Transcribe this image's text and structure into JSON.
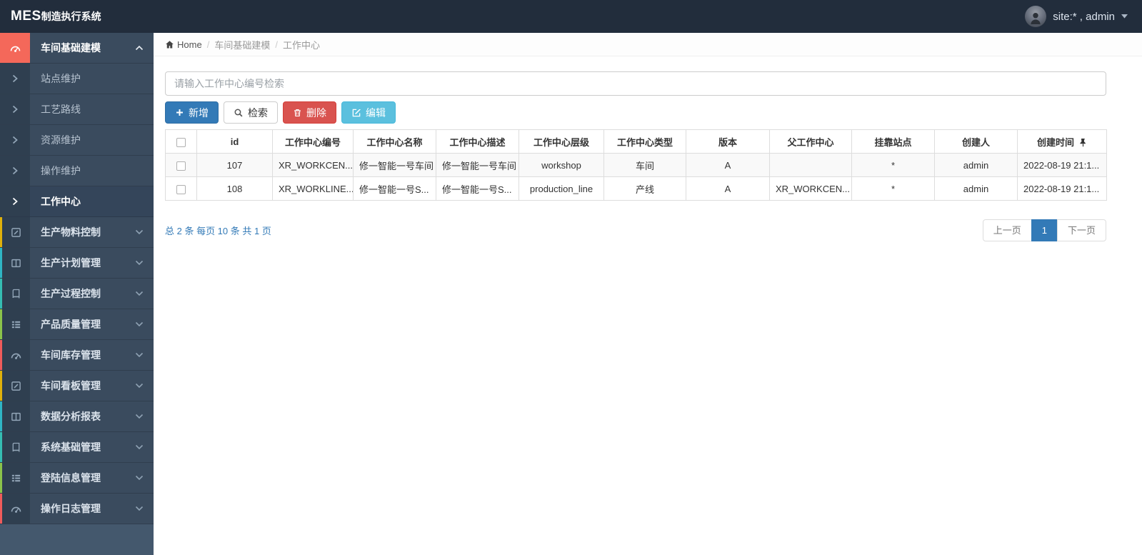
{
  "navbar": {
    "brand_bold": "MES",
    "brand_rest": "制造执行系统",
    "user_label": "site:* , admin"
  },
  "breadcrumb": {
    "items": [
      "Home",
      "车间基础建模",
      "工作中心"
    ]
  },
  "sidebar": {
    "active_group": {
      "label": "车间基础建模",
      "icon": "tachometer-icon"
    },
    "sub_items": [
      {
        "label": "站点维护",
        "active": false
      },
      {
        "label": "工艺路线",
        "active": false
      },
      {
        "label": "资源维护",
        "active": false
      },
      {
        "label": "操作维护",
        "active": false
      },
      {
        "label": "工作中心",
        "active": true
      }
    ],
    "groups": [
      {
        "label": "生产物料控制",
        "icon": "pencil-square-icon",
        "accent": "#dfb10b"
      },
      {
        "label": "生产计划管理",
        "icon": "columns-icon",
        "accent": "#2fb5c4"
      },
      {
        "label": "生产过程控制",
        "icon": "book-icon",
        "accent": "#35bdb2"
      },
      {
        "label": "产品质量管理",
        "icon": "th-list-icon",
        "accent": "#8bc34a"
      },
      {
        "label": "车间库存管理",
        "icon": "tachometer-icon",
        "accent": "#ef5b5b"
      },
      {
        "label": "车间看板管理",
        "icon": "pencil-square-icon",
        "accent": "#dfb10b"
      },
      {
        "label": "数据分析报表",
        "icon": "columns-icon",
        "accent": "#2fb5c4"
      },
      {
        "label": "系统基础管理",
        "icon": "book-icon",
        "accent": "#35bdb2"
      },
      {
        "label": "登陆信息管理",
        "icon": "th-list-icon",
        "accent": "#8bc34a"
      },
      {
        "label": "操作日志管理",
        "icon": "tachometer-icon",
        "accent": "#ef5b5b"
      }
    ]
  },
  "search": {
    "placeholder": "请输入工作中心编号检索",
    "value": ""
  },
  "toolbar": {
    "buttons": [
      {
        "label": "新增",
        "icon": "plus-icon",
        "variant": "primary"
      },
      {
        "label": "检索",
        "icon": "search-icon",
        "variant": "default"
      },
      {
        "label": "删除",
        "icon": "trash-icon",
        "variant": "danger"
      },
      {
        "label": "编辑",
        "icon": "edit-icon",
        "variant": "info"
      }
    ]
  },
  "table": {
    "columns": [
      {
        "label": "id"
      },
      {
        "label": "工作中心编号"
      },
      {
        "label": "工作中心名称"
      },
      {
        "label": "工作中心描述"
      },
      {
        "label": "工作中心层级"
      },
      {
        "label": "工作中心类型"
      },
      {
        "label": "版本"
      },
      {
        "label": "父工作中心"
      },
      {
        "label": "挂靠站点"
      },
      {
        "label": "创建人"
      },
      {
        "label": "创建时间",
        "icon": "pin-icon"
      }
    ],
    "rows": [
      [
        "107",
        "XR_WORKCEN...",
        "修一智能一号车间",
        "修一智能一号车间",
        "workshop",
        "车间",
        "A",
        "",
        "*",
        "admin",
        "2022-08-19 21:1..."
      ],
      [
        "108",
        "XR_WORKLINE...",
        "修一智能一号S...",
        "修一智能一号S...",
        "production_line",
        "产线",
        "A",
        "XR_WORKCEN...",
        "*",
        "admin",
        "2022-08-19 21:1..."
      ]
    ]
  },
  "footer": {
    "summary": "总 2 条 每页 10 条 共 1 页",
    "pager": {
      "prev": "上一页",
      "current": "1",
      "next": "下一页"
    }
  },
  "colors": {
    "navbar": "#222d3c",
    "sidebar_row": "#3a4b5e",
    "sidebar_icon_col": "#2f3f50",
    "active_group_red": "#f4685a",
    "primary": "#337ab7",
    "danger": "#d9534f",
    "info": "#5bc0de",
    "link": "#337ab7"
  }
}
